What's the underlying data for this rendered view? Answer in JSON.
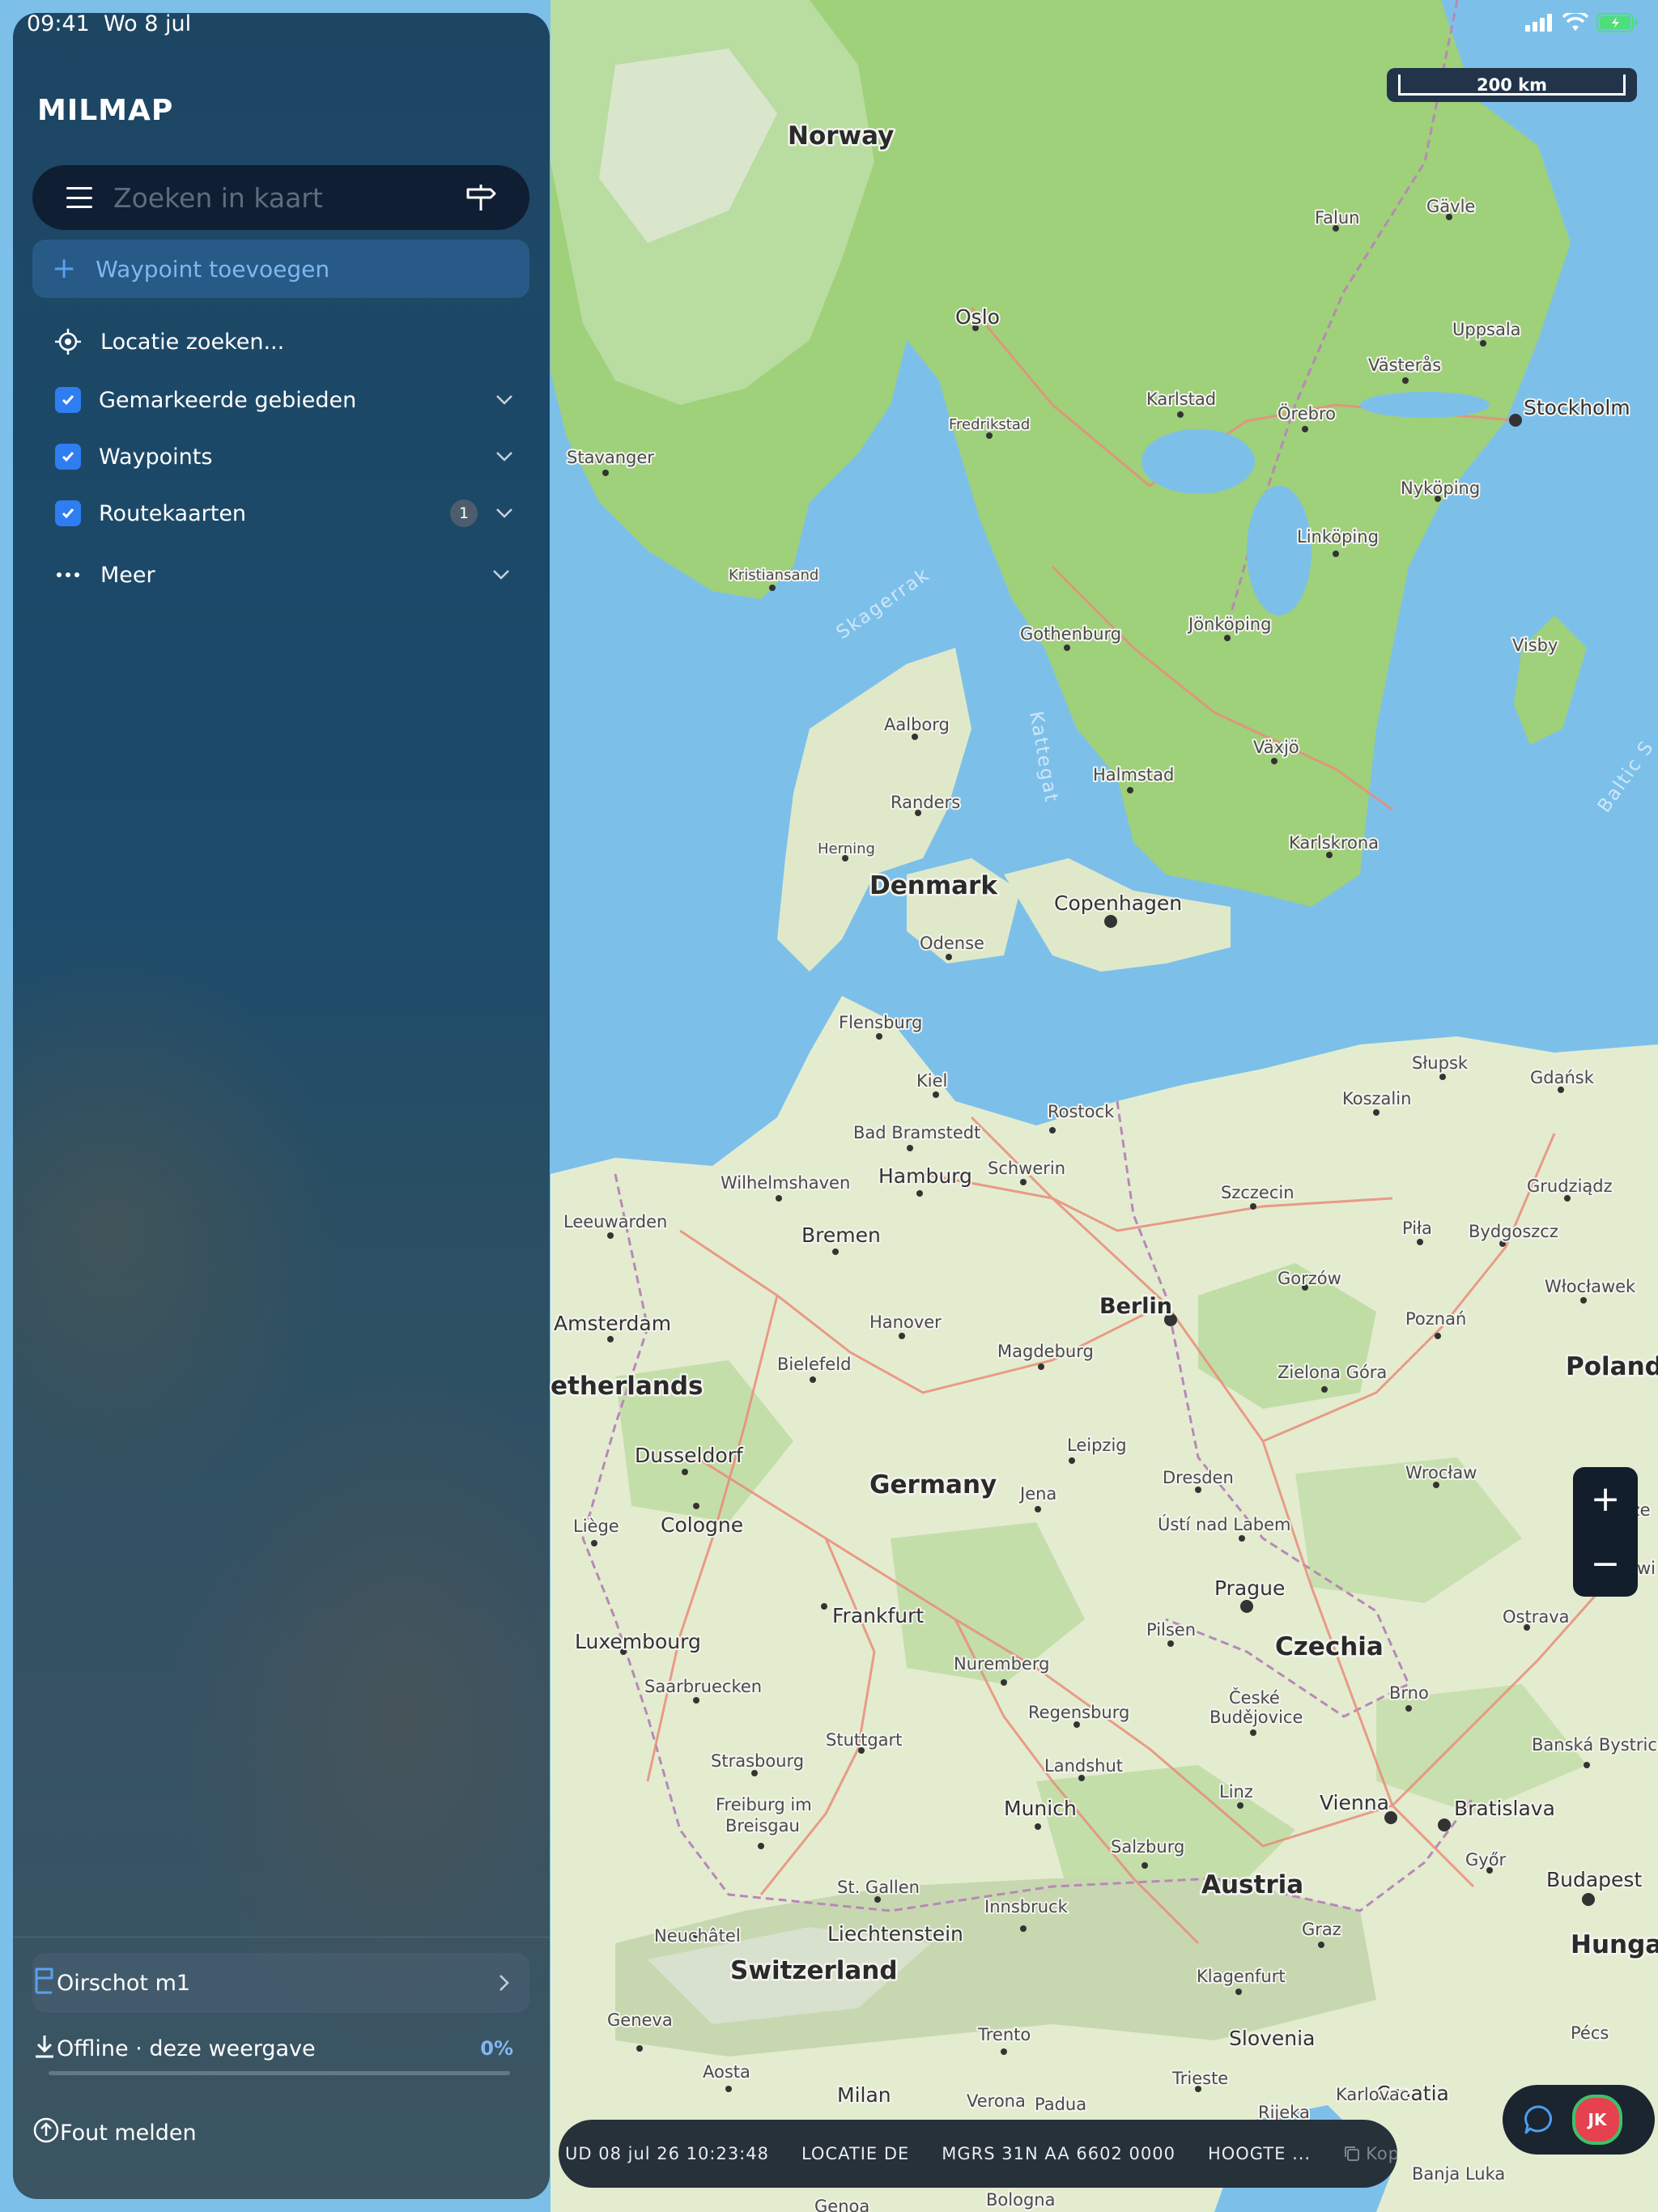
{
  "status_bar": {
    "time": "09:41",
    "date": "Wo 8 jul"
  },
  "sidebar": {
    "logo": "MILMAP",
    "search": {
      "placeholder": "Zoeken in kaart"
    },
    "add_waypoint": "Waypoint toevoegen",
    "find_location": "Locatie zoeken...",
    "layers": [
      {
        "label": "Gemarkeerde gebieden",
        "checked": true
      },
      {
        "label": "Waypoints",
        "checked": true
      },
      {
        "label": "Routekaarten",
        "checked": true,
        "badge": "1"
      }
    ],
    "more": "Meer",
    "saved_view": "Oirschot m1",
    "offline": {
      "label": "Offline · deze weergave",
      "percent": "0%",
      "progress": 0
    },
    "report": "Fout melden"
  },
  "map": {
    "scale_label": "200 km",
    "zoom_in": "+",
    "zoom_out": "−",
    "countries": [
      "Norway",
      "Denmark",
      "Germany",
      "Poland",
      "Czechia",
      "Austria",
      "Switzerland",
      "etherlands",
      "Hungar",
      "Slovenia",
      "Croatia",
      "Liechtenstein"
    ],
    "seas": [
      "Skagerrak",
      "Kattegat",
      "Baltic S"
    ],
    "cities": [
      "Oslo",
      "Stockholm",
      "Copenhagen",
      "Berlin",
      "Hamburg",
      "Prague",
      "Vienna",
      "Munich",
      "Frankfurt",
      "Amsterdam",
      "Cologne",
      "Dusseldorf",
      "Bremen",
      "Hanover",
      "Leipzig",
      "Dresden",
      "Nuremberg",
      "Stuttgart",
      "Gothenburg",
      "Aalborg",
      "Falun",
      "Gavle",
      "Uppsala",
      "Vasteras",
      "Orebro",
      "Karlstad",
      "Fredrikstad",
      "Stavanger",
      "Kristiansand",
      "Nykoping",
      "Linkoping",
      "Jonkoping",
      "Visby",
      "Vaxjo",
      "Halmstad",
      "Karlskrona",
      "Randers",
      "Herning",
      "Odense",
      "Flensburg",
      "Kiel",
      "Rostock",
      "Bad Bramstedt",
      "Schwerin",
      "Wilhelmshaven",
      "Leeuwarden",
      "Szczecin",
      "Koszalin",
      "Slupsk",
      "Gdansk",
      "Grudziadz",
      "Pila",
      "Bydgoszcz",
      "Wloclawek",
      "Gorzow",
      "Poznan",
      "Zielona Gora",
      "Wroclaw",
      "Bielefeld",
      "Magdeburg",
      "Jena",
      "Usti nad Labem",
      "Liege",
      "Luxembourg",
      "Saarbruecken",
      "Strasbourg",
      "Freiburg im Breisgau",
      "Regensburg",
      "Landshut",
      "Pilsen",
      "Ceske Budejovice",
      "Brno",
      "Ostrava",
      "Gliwi",
      "Cze",
      "Banska Bystrica",
      "Bratislava",
      "Gyor",
      "Budapest",
      "Linz",
      "Salzburg",
      "Innsbruck",
      "Graz",
      "Klagenfurt",
      "St. Gallen",
      "Neuchatel",
      "Geneva",
      "Aosta",
      "Trento",
      "Milan",
      "Verona",
      "Padua",
      "Trieste",
      "Karlovac",
      "Rijeka",
      "Bologna",
      "Banja Luka",
      "Genoa",
      "Pecs"
    ],
    "city_labels": {
      "oslo": "Oslo",
      "stockholm": "Stockholm",
      "copenhagen": "Copenhagen",
      "berlin": "Berlin",
      "hamburg": "Hamburg",
      "prague": "Prague",
      "vienna": "Vienna",
      "munich": "Munich",
      "frankfurt": "Frankfurt",
      "amsterdam": "Amsterdam",
      "cologne": "Cologne",
      "dusseldorf": "Dusseldorf",
      "bremen": "Bremen",
      "hanover": "Hanover",
      "leipzig": "Leipzig",
      "dresden": "Dresden",
      "nuremberg": "Nuremberg",
      "stuttgart": "Stuttgart",
      "gothenburg": "Gothenburg",
      "aalborg": "Aalborg",
      "falun": "Falun",
      "gavle": "Gävle",
      "uppsala": "Uppsala",
      "vasteras": "Västerås",
      "orebro": "Örebro",
      "karlstad": "Karlstad",
      "fredrikstad": "Fredrikstad",
      "stavanger": "Stavanger",
      "kristiansand": "Kristiansand",
      "nykoping": "Nyköping",
      "linkoping": "Linköping",
      "jonkoping": "Jönköping",
      "visby": "Visby",
      "vaxjo": "Växjö",
      "halmstad": "Halmstad",
      "karlskrona": "Karlskrona",
      "randers": "Randers",
      "herning": "Herning",
      "odense": "Odense",
      "flensburg": "Flensburg",
      "kiel": "Kiel",
      "rostock": "Rostock",
      "bad_bramstedt": "Bad Bramstedt",
      "schwerin": "Schwerin",
      "wilhelmshaven": "Wilhelmshaven",
      "leeuwarden": "Leeuwarden",
      "szczecin": "Szczecin",
      "koszalin": "Koszalin",
      "slupsk": "Słupsk",
      "gdansk": "Gdańsk",
      "grudziadz": "Grudziądz",
      "pila": "Piła",
      "bydgoszcz": "Bydgoszcz",
      "wloclawek": "Włocławek",
      "gorzow": "Gorzów",
      "poznan": "Poznań",
      "zielona_gora": "Zielona Góra",
      "wroclaw": "Wrocław",
      "bielefeld": "Bielefeld",
      "magdeburg": "Magdeburg",
      "jena": "Jena",
      "usti": "Ústí nad Labem",
      "liege": "Liège",
      "luxembourg": "Luxembourg",
      "saarbruecken": "Saarbruecken",
      "strasbourg": "Strasbourg",
      "freiburg1": "Freiburg im",
      "freiburg2": "Breisgau",
      "regensburg": "Regensburg",
      "landshut": "Landshut",
      "pilsen": "Pilsen",
      "ceske1": "České",
      "ceske2": "Budějovice",
      "brno": "Brno",
      "ostrava": "Ostrava",
      "gliwi": "Gliwi",
      "cze": "Cze",
      "banska": "Banská Bystrica",
      "bratislava": "Bratislava",
      "gyor": "Győr",
      "budapest": "Budapest",
      "linz": "Linz",
      "salzburg": "Salzburg",
      "innsbruck": "Innsbruck",
      "graz": "Graz",
      "klagenfurt": "Klagenfurt",
      "stgallen": "St. Gallen",
      "neuchatel": "Neuchâtel",
      "geneva": "Geneva",
      "aosta": "Aosta",
      "trento": "Trento",
      "milan": "Milan",
      "verona": "Verona",
      "padua": "Padua",
      "trieste": "Trieste",
      "karlovac": "Karlovac",
      "rijeka": "Rijeka",
      "bologna": "Bologna",
      "banja_luka": "Banja Luka",
      "genoa": "Genoa",
      "pecs": "Pécs"
    },
    "country_labels": {
      "norway": "Norway",
      "denmark": "Denmark",
      "germany": "Germany",
      "poland": "Poland",
      "czechia": "Czechia",
      "austria": "Austria",
      "switzerland": "Switzerland",
      "netherlands": "etherlands",
      "hungary": "Hungar",
      "slovenia": "Slovenia",
      "croatia": "Croatia",
      "liechtenstein": "Liechtenstein"
    },
    "sea_labels": {
      "skagerrak": "Skagerrak",
      "kattegat": "Kattegat",
      "baltic": "Baltic S"
    }
  },
  "info_bar": {
    "date": "UD 08 jul 26 10:23:48",
    "location": "LOCATIE DE",
    "mgrs": "MGRS 31N AA 6602 0000",
    "altitude": "HOOGTE ...",
    "copy": "Kopi"
  },
  "user": {
    "initials": "JK"
  },
  "colors": {
    "accent": "#2f7ef1",
    "sidebar": "#1d4663",
    "land": "#e6eed8",
    "water": "#7cc0ea",
    "forest": "#9fd07a"
  }
}
